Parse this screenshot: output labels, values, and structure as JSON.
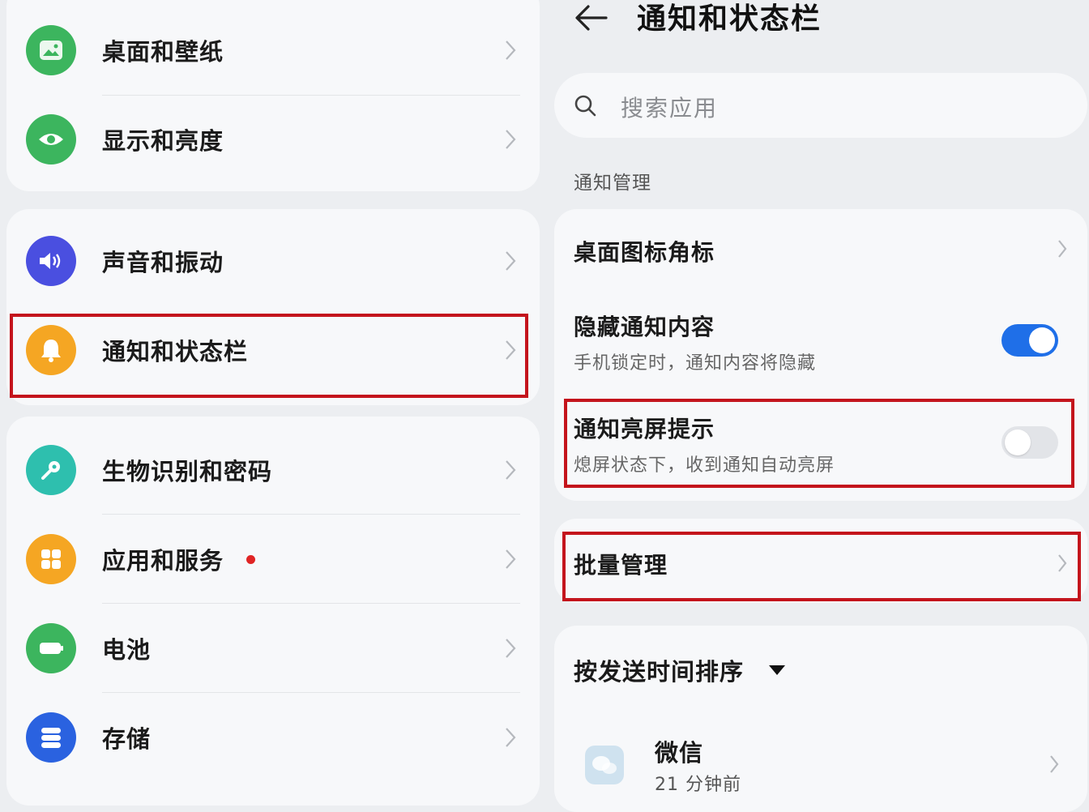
{
  "left_menu": {
    "group1": [
      {
        "label": "桌面和壁纸",
        "icon": "wallpaper-icon",
        "color": "#3cb55e"
      },
      {
        "label": "显示和亮度",
        "icon": "eye-icon",
        "color": "#3cb55e"
      }
    ],
    "group2": [
      {
        "label": "声音和振动",
        "icon": "speaker-icon",
        "color": "#4a4fe0"
      },
      {
        "label": "通知和状态栏",
        "icon": "bell-icon",
        "color": "#f5a623"
      }
    ],
    "group3": [
      {
        "label": "生物识别和密码",
        "icon": "key-icon",
        "color": "#2ebfae"
      },
      {
        "label": "应用和服务",
        "icon": "apps-icon",
        "color": "#f5a623"
      },
      {
        "label": "电池",
        "icon": "battery-icon",
        "color": "#3cb55e"
      },
      {
        "label": "存储",
        "icon": "storage-icon",
        "color": "#2a62e0"
      }
    ]
  },
  "header": {
    "title": "通知和状态栏"
  },
  "search": {
    "placeholder": "搜索应用"
  },
  "notification_section": {
    "label": "通知管理",
    "badge_item": {
      "title": "桌面图标角标"
    },
    "hide_content": {
      "title": "隐藏通知内容",
      "subtitle": "手机锁定时，通知内容将隐藏",
      "enabled": true
    },
    "wake_screen": {
      "title": "通知亮屏提示",
      "subtitle": "熄屏状态下，收到通知自动亮屏",
      "enabled": false
    },
    "batch_manage": {
      "title": "批量管理"
    }
  },
  "sort": {
    "label": "按发送时间排序"
  },
  "apps": [
    {
      "name": "微信",
      "time": "21 分钟前"
    }
  ],
  "colors": {
    "toggle_on": "#1f6fe8",
    "toggle_off": "#dfe1e5",
    "highlight": "#c4141c"
  }
}
